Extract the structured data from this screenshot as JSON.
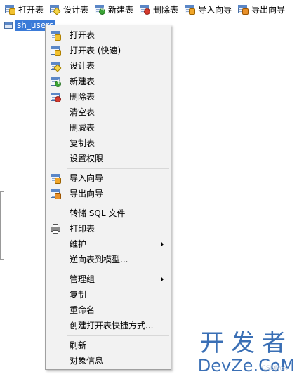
{
  "toolbar": {
    "buttons": [
      {
        "label": "打开表",
        "icon": "table-open-icon"
      },
      {
        "label": "设计表",
        "icon": "table-design-icon"
      },
      {
        "label": "新建表",
        "icon": "table-new-icon"
      },
      {
        "label": "删除表",
        "icon": "table-delete-icon"
      },
      {
        "label": "导入向导",
        "icon": "table-import-icon"
      },
      {
        "label": "导出向导",
        "icon": "table-export-icon"
      }
    ]
  },
  "tree": {
    "selected_item": "sh_users"
  },
  "context_menu": {
    "items": [
      {
        "label": "打开表",
        "icon": "table-open-icon"
      },
      {
        "label": "打开表 (快速)",
        "icon": "table-open-icon"
      },
      {
        "label": "设计表",
        "icon": "table-design-icon"
      },
      {
        "label": "新建表",
        "icon": "table-new-icon"
      },
      {
        "label": "删除表",
        "icon": "table-delete-icon"
      },
      {
        "label": "清空表"
      },
      {
        "label": "删减表"
      },
      {
        "label": "复制表"
      },
      {
        "label": "设置权限"
      },
      {
        "label": "导入向导",
        "icon": "table-import-icon"
      },
      {
        "label": "导出向导",
        "icon": "table-export-icon"
      },
      {
        "label": "转储 SQL 文件"
      },
      {
        "label": "打印表",
        "icon": "printer-icon"
      },
      {
        "label": "维护",
        "submenu": true
      },
      {
        "label": "逆向表到模型..."
      },
      {
        "label": "管理组",
        "submenu": true
      },
      {
        "label": "复制"
      },
      {
        "label": "重命名"
      },
      {
        "label": "创建打开表快捷方式..."
      },
      {
        "label": "刷新"
      },
      {
        "label": "对象信息"
      }
    ]
  },
  "watermark": {
    "line1": "开发者",
    "line2": "DevZe.CoM",
    "small": "CSDN@..."
  }
}
